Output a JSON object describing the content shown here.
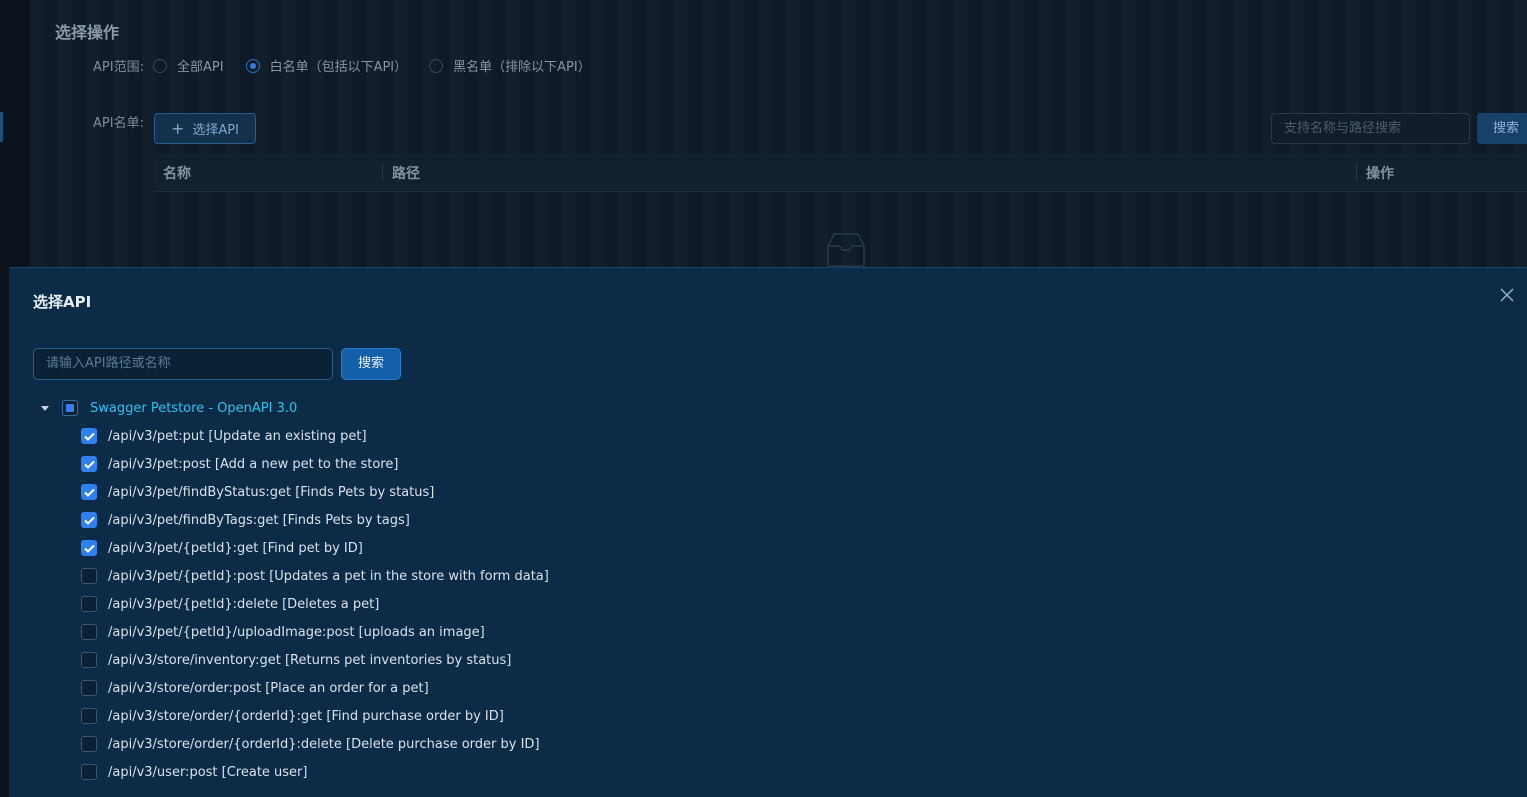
{
  "background": {
    "section_title": "选择操作",
    "scope_label": "API范围:",
    "scope_options": [
      {
        "label": "全部API",
        "selected": false
      },
      {
        "label": "白名单（包括以下API）",
        "selected": true
      },
      {
        "label": "黑名单（排除以下API）",
        "selected": false
      }
    ],
    "list_label": "API名单:",
    "select_api_button": "选择API",
    "search_placeholder": "支持名称与路径搜索",
    "search_button": "搜索",
    "table_columns": [
      "名称",
      "路径",
      "操作"
    ]
  },
  "modal": {
    "title": "选择API",
    "search_placeholder": "请输入API路径或名称",
    "search_button": "搜索",
    "tree_root": {
      "label": "Swagger Petstore - OpenAPI 3.0",
      "state": "indeterminate",
      "expanded": true
    },
    "items": [
      {
        "label": "/api/v3/pet:put [Update an existing pet]",
        "checked": true
      },
      {
        "label": "/api/v3/pet:post [Add a new pet to the store]",
        "checked": true
      },
      {
        "label": "/api/v3/pet/findByStatus:get [Finds Pets by status]",
        "checked": true
      },
      {
        "label": "/api/v3/pet/findByTags:get [Finds Pets by tags]",
        "checked": true
      },
      {
        "label": "/api/v3/pet/{petId}:get [Find pet by ID]",
        "checked": true
      },
      {
        "label": "/api/v3/pet/{petId}:post [Updates a pet in the store with form data]",
        "checked": false
      },
      {
        "label": "/api/v3/pet/{petId}:delete [Deletes a pet]",
        "checked": false
      },
      {
        "label": "/api/v3/pet/{petId}/uploadImage:post [uploads an image]",
        "checked": false
      },
      {
        "label": "/api/v3/store/inventory:get [Returns pet inventories by status]",
        "checked": false
      },
      {
        "label": "/api/v3/store/order:post [Place an order for a pet]",
        "checked": false
      },
      {
        "label": "/api/v3/store/order/{orderId}:get [Find purchase order by ID]",
        "checked": false
      },
      {
        "label": "/api/v3/store/order/{orderId}:delete [Delete purchase order by ID]",
        "checked": false
      },
      {
        "label": "/api/v3/user:post [Create user]",
        "checked": false
      }
    ]
  },
  "colors": {
    "accent": "#2f80ed",
    "root_label": "#2ec1f0",
    "modal_bg": "#0b2b47"
  }
}
